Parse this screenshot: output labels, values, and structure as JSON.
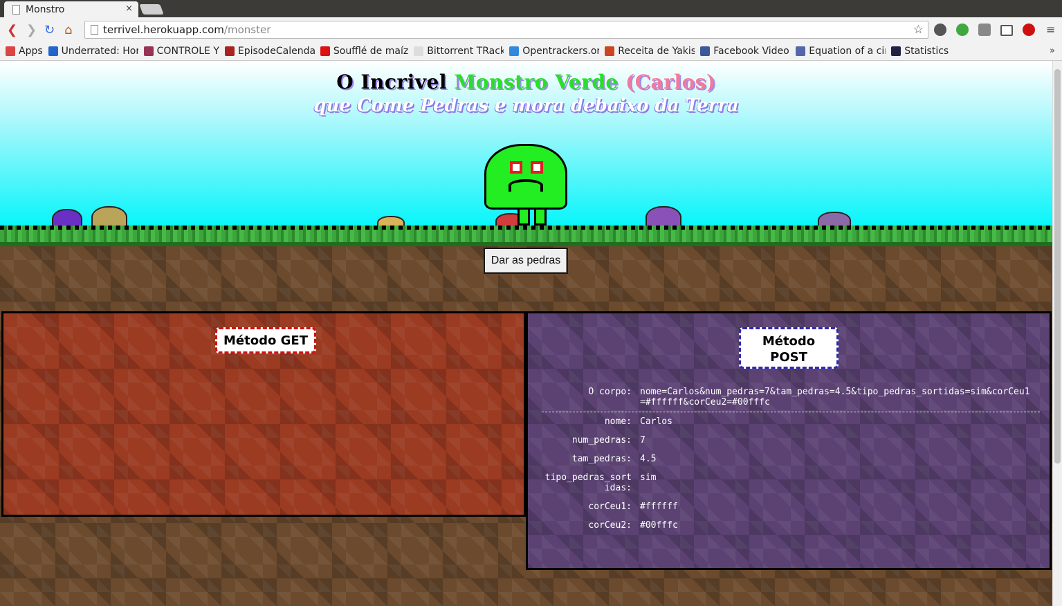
{
  "browser": {
    "tab_title": "Monstro",
    "tab_close": "×",
    "url_host": "terrivel.herokuapp.com",
    "url_path": "/monster",
    "bookmarks": [
      {
        "label": "Apps",
        "color": "#d44"
      },
      {
        "label": "Underrated: Horr",
        "color": "#2266cc"
      },
      {
        "label": "CONTROLE Y",
        "color": "#993355"
      },
      {
        "label": "EpisodeCalendar",
        "color": "#aa2222"
      },
      {
        "label": "Soufflé de maíz",
        "color": "#dd1111"
      },
      {
        "label": "Bittorrent TRacke",
        "color": "#dddddd"
      },
      {
        "label": "Opentrackers.org",
        "color": "#3388dd"
      },
      {
        "label": "Receita de Yakiss",
        "color": "#cc4422"
      },
      {
        "label": "Facebook Video D",
        "color": "#3b5998"
      },
      {
        "label": "Equation of a circ",
        "color": "#5566aa"
      },
      {
        "label": "Statistics",
        "color": "#222244"
      }
    ],
    "bookmarks_more": "»"
  },
  "page": {
    "title_part1": "O Incrivel ",
    "title_part2": "Monstro Verde",
    "title_part3": " (Carlos)",
    "subtitle": "que Come Pedras e mora debaixo da Terra",
    "button_label": "Dar as pedras"
  },
  "get_panel": {
    "title": "Método GET"
  },
  "post_panel": {
    "title_line1": "Método",
    "title_line2": "POST",
    "body_key": "O corpo:",
    "body_value": "nome=Carlos&num_pedras=7&tam_pedras=4.5&tipo_pedras_sortidas=sim&corCeu1=#ffffff&corCeu2=#00fffc",
    "fields": [
      {
        "key": "nome:",
        "value": "Carlos"
      },
      {
        "key": "num_pedras:",
        "value": "7"
      },
      {
        "key": "tam_pedras:",
        "value": "4.5"
      },
      {
        "key": "tipo_pedras_sortidas:",
        "value": "sim"
      },
      {
        "key": "corCeu1:",
        "value": "#ffffff"
      },
      {
        "key": "corCeu2:",
        "value": "#00fffc"
      }
    ]
  },
  "colors": {
    "sky_bottom": "#00fffc",
    "sky_top": "#ffffff",
    "monster": "#22ee22"
  }
}
